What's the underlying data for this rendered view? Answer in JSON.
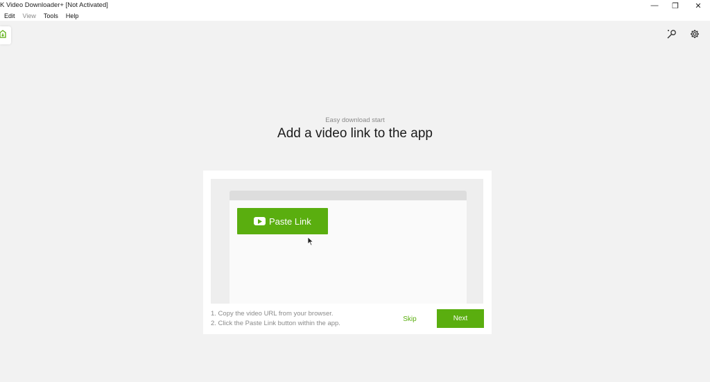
{
  "window": {
    "title": "K Video Downloader+ [Not Activated]",
    "minimize_glyph": "—",
    "restore_glyph": "❐",
    "close_glyph": "✕"
  },
  "menu": {
    "items": [
      {
        "label": "Edit",
        "enabled": true
      },
      {
        "label": "View",
        "enabled": false
      },
      {
        "label": "Tools",
        "enabled": true
      },
      {
        "label": "Help",
        "enabled": true
      }
    ]
  },
  "icons": {
    "nav": "download-home-icon",
    "smart_mode": "smart-mode-icon",
    "settings": "gear-icon"
  },
  "onboarding": {
    "subtitle": "Easy download start",
    "title": "Add a video link to the app",
    "paste_button_label": "Paste Link",
    "instructions": [
      "1. Copy the video URL from your browser.",
      "2. Click the Paste Link button within the app."
    ],
    "skip_label": "Skip",
    "next_label": "Next"
  },
  "colors": {
    "accent": "#5aae0f",
    "background": "#f2f2f2",
    "card": "#ffffff",
    "muted_text": "#8a8a8a"
  }
}
